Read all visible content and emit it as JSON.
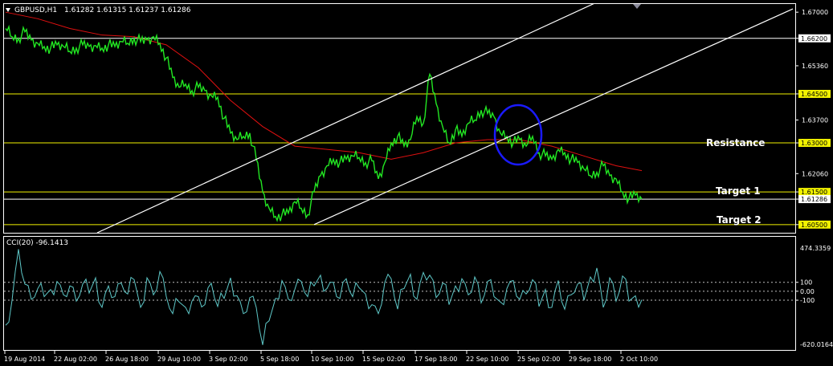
{
  "header": {
    "symbol": "GBPUSD,H1",
    "ohlc": "1.61282 1.61315 1.61237 1.61286"
  },
  "indicator": {
    "label": "CCI(20) -96.1413",
    "top_value": "474.3359",
    "bottom_value": "-620.0164",
    "levels": [
      "100",
      "0.00",
      "-100"
    ],
    "level_values": [
      100,
      0,
      -100
    ],
    "ylim": [
      -620.0164,
      474.3359
    ],
    "color": "#5ec8c8"
  },
  "annotations": {
    "resistance": "Resistance",
    "target1": "Target 1",
    "target2": "Target 2"
  },
  "colors": {
    "price": "#22e622",
    "ma": "#e01010",
    "hline": "#f2f200",
    "trendline": "#ffffff",
    "circle": "#1a1aff",
    "background": "#000000"
  },
  "chart_data": [
    {
      "type": "line",
      "ylim": [
        1.6025,
        1.6725
      ],
      "price_axis_labels": [
        "1.67000",
        "1.66200",
        "1.65360",
        "1.64500",
        "1.63700",
        "1.63000",
        "1.62060",
        "1.61500",
        "1.61286",
        "1.60500"
      ],
      "boxed_labels": [
        "1.66200",
        "1.64500",
        "1.63000",
        "1.61500",
        "1.61286",
        "1.60500"
      ],
      "horizontal_levels": [
        1.662,
        1.645,
        1.63,
        1.615,
        1.6128,
        1.605
      ],
      "time_labels": [
        "19 Aug 2014",
        "22 Aug 02:00",
        "26 Aug 18:00",
        "29 Aug 10:00",
        "3 Sep 02:00",
        "5 Sep 18:00",
        "10 Sep 10:00",
        "15 Sep 02:00",
        "17 Sep 18:00",
        "22 Sep 10:00",
        "25 Sep 02:00",
        "29 Sep 18:00",
        "2 Oct 10:00"
      ],
      "series": [
        {
          "x": [
            0,
            4,
            8,
            12,
            16,
            20,
            24,
            28,
            32,
            36,
            40,
            44,
            48,
            52,
            56,
            60,
            64,
            68,
            72,
            76,
            80,
            84,
            88,
            92,
            96,
            100,
            104,
            108,
            112,
            116,
            120,
            124,
            128,
            132,
            136,
            140,
            144,
            148,
            152,
            156,
            160,
            164,
            168,
            172,
            176,
            180,
            184,
            188,
            192,
            196,
            200,
            204,
            208,
            212,
            216,
            220,
            224,
            228,
            232,
            236,
            240,
            244,
            248,
            252,
            256,
            260,
            264,
            268,
            272,
            276,
            280,
            284,
            288,
            292,
            296,
            300,
            304,
            308,
            312,
            316,
            320,
            324,
            328,
            332,
            336,
            340,
            344,
            348,
            352,
            356,
            360,
            364,
            368,
            372,
            376,
            380,
            384,
            388,
            392,
            396
          ],
          "values": [
            1.665,
            1.6625,
            1.662,
            1.664,
            1.6615,
            1.6605,
            1.6595,
            1.659,
            1.66,
            1.6595,
            1.658,
            1.659,
            1.66,
            1.6595,
            1.6598,
            1.659,
            1.66,
            1.6595,
            1.661,
            1.6605,
            1.662,
            1.661,
            1.6615,
            1.6625,
            1.6605,
            1.656,
            1.65,
            1.647,
            1.648,
            1.646,
            1.647,
            1.646,
            1.6445,
            1.644,
            1.6375,
            1.633,
            1.631,
            1.632,
            1.633,
            1.625,
            1.615,
            1.61,
            1.6075,
            1.608,
            1.6085,
            1.612,
            1.61,
            1.608,
            1.615,
            1.62,
            1.623,
            1.625,
            1.624,
            1.625,
            1.626,
            1.6255,
            1.624,
            1.6245,
            1.619,
            1.624,
            1.63,
            1.632,
            1.629,
            1.631,
            1.638,
            1.636,
            1.651,
            1.642,
            1.635,
            1.63,
            1.634,
            1.632,
            1.636,
            1.637,
            1.64,
            1.639,
            1.638,
            1.633,
            1.632,
            1.63,
            1.631,
            1.629,
            1.632,
            1.627,
            1.626,
            1.625,
            1.628,
            1.627,
            1.625,
            1.624,
            1.622,
            1.62,
            1.621,
            1.623,
            1.62,
            1.619,
            1.615,
            1.613,
            1.614,
            1.6128
          ]
        },
        {
          "x": [
            0,
            20,
            40,
            60,
            80,
            100,
            120,
            140,
            160,
            180,
            200,
            220,
            240,
            260,
            280,
            300,
            320,
            340,
            360,
            380,
            396
          ],
          "values": [
            1.67,
            1.668,
            1.665,
            1.663,
            1.6625,
            1.66,
            1.653,
            1.643,
            1.635,
            1.629,
            1.628,
            1.627,
            1.625,
            1.627,
            1.63,
            1.631,
            1.631,
            1.629,
            1.626,
            1.623,
            1.6215
          ]
        }
      ],
      "trendlines": [
        {
          "x": [
            57,
            370
          ],
          "values": [
            1.6025,
            1.6735
          ]
        },
        {
          "x": [
            192,
            490
          ],
          "values": [
            1.605,
            1.671
          ]
        }
      ]
    },
    {
      "type": "line",
      "ylim": [
        -620.0164,
        474.3359
      ],
      "series": [
        {
          "x": [
            0,
            4,
            8,
            12,
            16,
            20,
            24,
            28,
            32,
            36,
            40,
            44,
            48,
            52,
            56,
            60,
            64,
            68,
            72,
            76,
            80,
            84,
            88,
            92,
            96,
            100,
            104,
            108,
            112,
            116,
            120,
            124,
            128,
            132,
            136,
            140,
            144,
            148,
            152,
            156,
            160,
            164,
            168,
            172,
            176,
            180,
            184,
            188,
            192,
            196,
            200,
            204,
            208,
            212,
            216,
            220,
            224,
            228,
            232,
            236,
            240,
            244,
            248,
            252,
            256,
            260,
            264,
            268,
            272,
            276,
            280,
            284,
            288,
            292,
            296,
            300,
            304,
            308,
            312,
            316,
            320,
            324,
            328,
            332,
            336,
            340,
            344,
            348,
            352,
            356,
            360,
            364,
            368,
            372,
            376,
            380,
            384,
            388,
            392,
            396
          ],
          "values": [
            -380,
            -100,
            470,
            80,
            -90,
            30,
            -60,
            20,
            110,
            -40,
            60,
            -110,
            80,
            -20,
            150,
            -180,
            60,
            -60,
            90,
            -30,
            130,
            -180,
            150,
            -40,
            220,
            -60,
            -250,
            -120,
            -180,
            -110,
            -60,
            -150,
            90,
            -170,
            -80,
            150,
            -50,
            -250,
            -70,
            -180,
            -600,
            -330,
            -80,
            120,
            -90,
            20,
            110,
            -60,
            60,
            180,
            30,
            100,
            -80,
            140,
            -60,
            40,
            -30,
            -150,
            -250,
            100,
            140,
            -200,
            30,
            190,
            -90,
            210,
            180,
            -70,
            90,
            -150,
            60,
            140,
            -40,
            160,
            -130,
            110,
            -60,
            -120,
            30,
            120,
            -90,
            -30,
            130,
            -170,
            20,
            -180,
            120,
            -200,
            -40,
            80,
            -100,
            160,
            260,
            -180,
            150,
            -110,
            170,
            -110,
            -50,
            -96
          ]
        }
      ]
    }
  ]
}
